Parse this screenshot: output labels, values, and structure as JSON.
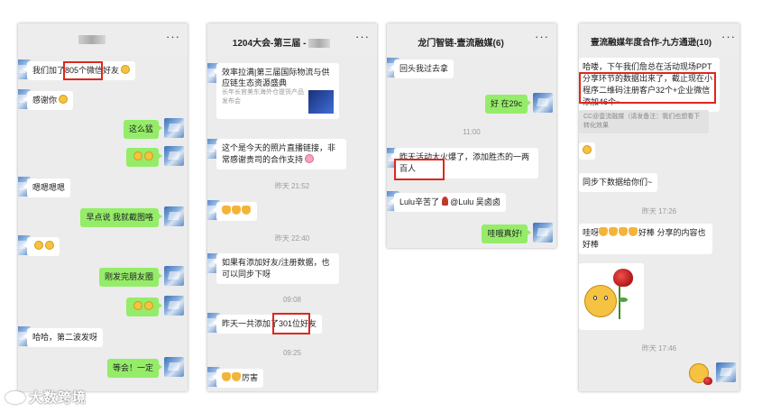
{
  "watermark": {
    "text": "大数跨境"
  },
  "highlight_color": "#e0261d",
  "bubble_colors": {
    "sent": "#95ec69",
    "received": "#ffffff",
    "background": "#ececec"
  },
  "phones": [
    {
      "title_suffix": "",
      "more_icon": "···",
      "messages": [
        {
          "side": "left",
          "text": "我们加了805个微信好友",
          "emoji": "smile-emoji"
        },
        {
          "side": "left",
          "text": "感谢你",
          "emoji": "smile-emoji"
        },
        {
          "side": "right",
          "text": "这么猛"
        },
        {
          "side": "right",
          "text": "",
          "emoji": "grin-emoji-pair"
        },
        {
          "side": "left",
          "text": "嗯嗯嗯嗯"
        },
        {
          "side": "right",
          "text": "早点说 我就截图咯"
        },
        {
          "side": "left",
          "text": "",
          "emoji": "laugh-emoji-pair"
        },
        {
          "side": "right",
          "text": "刚发完朋友圈"
        },
        {
          "side": "right",
          "text": "",
          "emoji": "grin-emoji-pair"
        },
        {
          "side": "left",
          "text": "哈哈，第二波发呀"
        },
        {
          "side": "right",
          "text": "等会！一定"
        }
      ]
    },
    {
      "title": "1204大会-第三届 -",
      "more_icon": "···",
      "card": {
        "title": "效率拉满|第三届国际物流与供应链生态资源盛典",
        "desc": "长年长官美东海外仓提货产品发布会"
      },
      "messages": [
        {
          "side": "left",
          "text": "这个是今天的照片直播链接，非常感谢贵司的合作支持",
          "emoji": "flower-emoji"
        },
        {
          "side": "left",
          "text": "",
          "emoji": "clap-x3"
        },
        {
          "side": "left",
          "text": "如果有添加好友/注册数据，也可以同步下呀"
        },
        {
          "side": "left",
          "text": "昨天一共添加了301位好友"
        },
        {
          "side": "left",
          "text": "厉害",
          "emoji": "thumbs-up-x2"
        }
      ],
      "timestamps": [
        "昨天 21:52",
        "昨天 22:40",
        "09:08",
        "09:25"
      ]
    },
    {
      "title": "龙门智链-壹流融媒(6)",
      "more_icon": "···",
      "messages": [
        {
          "side": "left",
          "text": "回头我过去拿"
        },
        {
          "side": "right",
          "text": "好 在29c"
        },
        {
          "side": "left",
          "text": "昨天活动太火爆了，添加胜杰的一两百人"
        },
        {
          "side": "left",
          "text": "Lulu辛苦了",
          "mention": "@Lulu 吴卤卤"
        },
        {
          "side": "right",
          "text": "哇哦真好!"
        }
      ],
      "timestamps": [
        "11:00"
      ]
    },
    {
      "title": "壹流融媒年度合作-九方通逊(10)",
      "more_icon": "···",
      "messages": [
        {
          "side": "left",
          "text": "哈喽，下午我们詹总在活动现场PPT分享环节的数据出来了，截止现在小程序二维码注册客户32个+企业微信添加46个~"
        },
        {
          "side": "left",
          "text": "CC@壹流融媒（请发备注：我们也想看下转化效果"
        },
        {
          "side": "left",
          "text": "",
          "emoji": "smile-emoji"
        },
        {
          "side": "left",
          "text": "同步下数据给你们~"
        },
        {
          "side": "left",
          "text": "哇呀👍👍👍👍好棒 分享的内容也好棒"
        },
        {
          "side": "right",
          "text": "",
          "emoji": "rose-emoji"
        }
      ],
      "timestamps": [
        "昨天 17:26",
        "昨天 17:46"
      ]
    }
  ],
  "panel1": {
    "m1": "我们加了805个微信好友",
    "m2": "感谢你",
    "m3": "这么猛",
    "m5": "嗯嗯嗯嗯",
    "m6": "早点说 我就截图咯",
    "m8": "刚发完朋友圈",
    "m10": "哈哈，第二波发呀",
    "m11": "等会！一定"
  },
  "panel2": {
    "title": "1204大会-第三届 -",
    "card_title": "效率拉满|第三届国际物流与供应链生态资源盛典",
    "card_desc": "长年长官美东海外仓提货产品发布会",
    "m1": "这个是今天的照片直播链接，非常感谢贵司的合作支持",
    "t1": "昨天 21:52",
    "t2": "昨天 22:40",
    "m3": "如果有添加好友/注册数据，也可以同步下呀",
    "t3": "09:08",
    "m4": "昨天一共添加了301位好友",
    "t4": "09:25",
    "m5": "厉害"
  },
  "panel3": {
    "title": "龙门智链-壹流融媒(6)",
    "m1": "回头我过去拿",
    "t1": "11:00",
    "m2": "好 在29c",
    "m3": "昨天活动太火爆了，添加胜杰的一两百人",
    "m4": "Lulu辛苦了",
    "m4_mention": "@Lulu 吴卤卤",
    "m5": "哇哦真好!"
  },
  "panel4": {
    "title": "壹流融媒年度合作-九方通逊(10)",
    "m1": "哈喽，下午我们詹总在活动现场PPT分享环节的数据出来了，截止现在小程序二维码注册客户32个+企业微信添加46个~",
    "quote": "CC@壹流融媒（请发备注：我们也想看下转化效果",
    "t1": "昨天 17:26",
    "m3": "同步下数据给你们~",
    "m4": "哇呀",
    "m4b": "好棒 分享的内容也好棒",
    "t2": "昨天 17:46"
  },
  "more": "···"
}
